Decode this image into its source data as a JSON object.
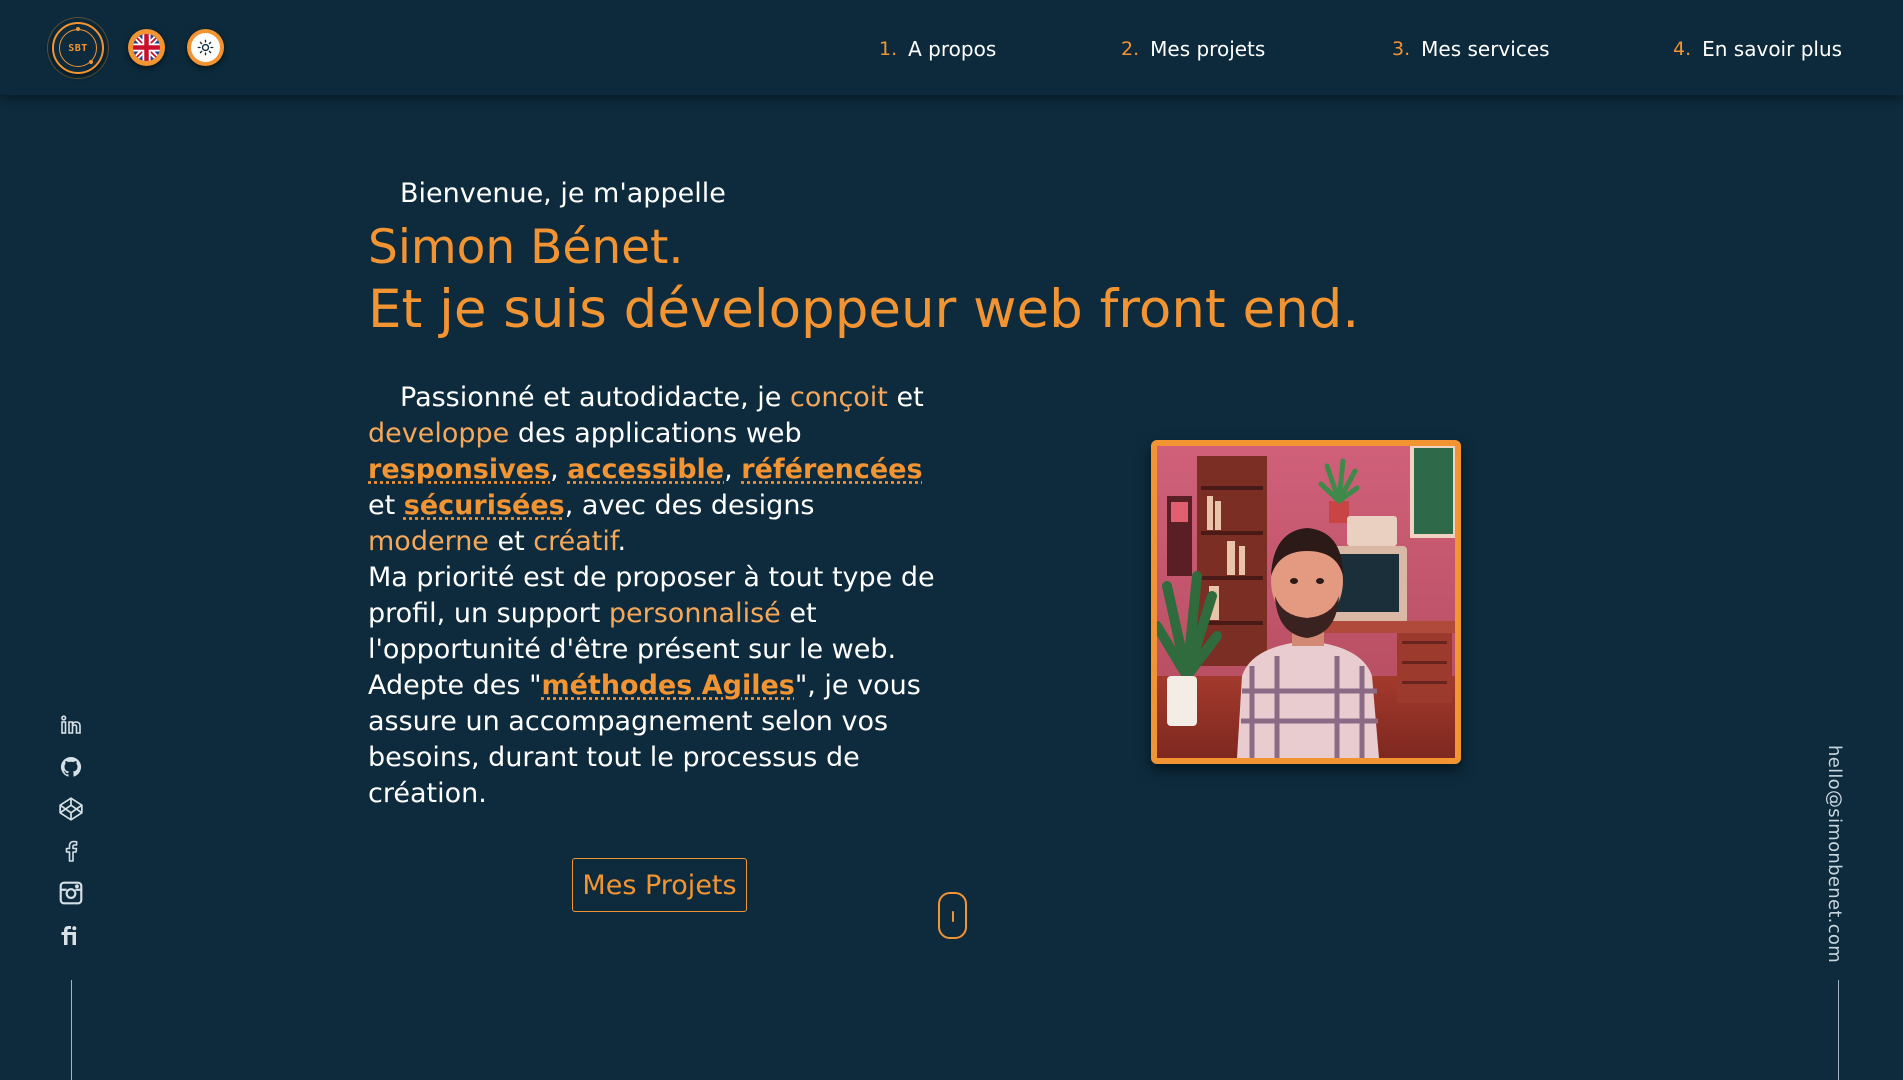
{
  "header": {
    "logo_text": "SBT",
    "nav": [
      {
        "num": "1.",
        "label": "A propos"
      },
      {
        "num": "2.",
        "label": "Mes projets"
      },
      {
        "num": "3.",
        "label": "Mes services"
      },
      {
        "num": "4.",
        "label": "En savoir plus"
      }
    ],
    "language_icon": "uk-flag-icon",
    "theme_icon": "sun-icon"
  },
  "hero": {
    "greeting": "Bienvenue, je m'appelle",
    "name": "Simon Bénet.",
    "tagline": "Et je suis développeur web front end.",
    "intro": {
      "p1_a": "Passionné et autodidacte, je ",
      "p1_conceive": "conçoit",
      "p1_b": " et ",
      "p1_develop": "developpe",
      "p1_c": " des applications web ",
      "p1_responsive": "responsives",
      "p1_sep1": ", ",
      "p1_accessible": "accessible",
      "p1_sep2": ", ",
      "p1_referenced": "référencées",
      "p1_d": " et ",
      "p1_secured": "sécurisées",
      "p1_e": ", avec des designs ",
      "p1_modern": "moderne",
      "p1_f": " et ",
      "p1_creative": "créatif",
      "p1_g": ".",
      "p2_a": "Ma priorité est de proposer à tout type de profil, un support ",
      "p2_personalized": "personnalisé",
      "p2_b": " et l'opportunité d'être présent sur le web.",
      "p3_a": "Adepte des \"",
      "p3_agile": "méthodes Agiles",
      "p3_b": "\", je vous assure un accompagnement selon vos besoins, durant tout le processus de création."
    },
    "cta_label": "Mes Projets"
  },
  "social": [
    "linkedin-icon",
    "github-icon",
    "codepen-icon",
    "facebook-icon",
    "instagram-icon",
    "fiverr-icon"
  ],
  "email": "hello@simonbenet.com",
  "colors": {
    "background": "#0d2b3d",
    "accent": "#f39433",
    "text": "#ffffff"
  }
}
